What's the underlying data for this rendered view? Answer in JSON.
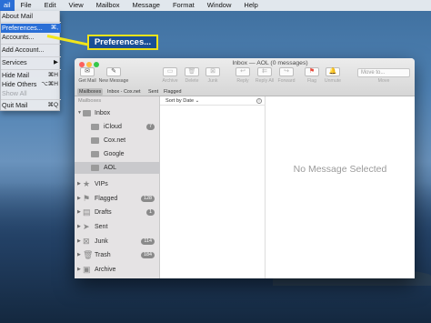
{
  "menubar": {
    "items": [
      "ail",
      "File",
      "Edit",
      "View",
      "Mailbox",
      "Message",
      "Format",
      "Window",
      "Help"
    ]
  },
  "app_menu": {
    "items": [
      {
        "label": "About Mail",
        "shortcut": ""
      },
      {
        "label": "Preferences...",
        "shortcut": "⌘,"
      },
      {
        "label": "Accounts...",
        "shortcut": ""
      },
      {
        "label": "Add Account...",
        "shortcut": ""
      },
      {
        "label": "Services",
        "shortcut": "▶"
      },
      {
        "label": "Hide Mail",
        "shortcut": "⌘H"
      },
      {
        "label": "Hide Others",
        "shortcut": "⌥⌘H"
      },
      {
        "label": "Show All",
        "shortcut": ""
      },
      {
        "label": "Quit Mail",
        "shortcut": "⌘Q"
      }
    ]
  },
  "callout": {
    "label": "Preferences..."
  },
  "window": {
    "title": "Inbox — AOL (0 messages)",
    "toolbar": {
      "get_mail": "Get Mail",
      "new_message": "New Message",
      "archive": "Archive",
      "delete": "Delete",
      "junk": "Junk",
      "reply": "Reply",
      "reply_all": "Reply All",
      "forward": "Forward",
      "flag": "Flag",
      "unmute": "Unmute",
      "move_to": "Move to...",
      "move": "Move"
    },
    "favorites": [
      "Mailboxes",
      "Inbox - Cox.net",
      "Sent",
      "Flagged"
    ]
  },
  "sidebar": {
    "heading": "Mailboxes",
    "inbox": "Inbox",
    "accounts": [
      {
        "label": "iCloud",
        "count": "7"
      },
      {
        "label": "Cox.net",
        "count": ""
      },
      {
        "label": "Google",
        "count": ""
      },
      {
        "label": "AOL",
        "count": ""
      }
    ],
    "folders": [
      {
        "label": "VIPs",
        "count": ""
      },
      {
        "label": "Flagged",
        "count": "128"
      },
      {
        "label": "Drafts",
        "count": "1"
      },
      {
        "label": "Sent",
        "count": ""
      },
      {
        "label": "Junk",
        "count": "114"
      },
      {
        "label": "Trash",
        "count": "184"
      },
      {
        "label": "Archive",
        "count": ""
      }
    ]
  },
  "message_list": {
    "sort_label": "Sort by Date ⌄"
  },
  "viewer": {
    "empty_text": "No Message Selected"
  }
}
